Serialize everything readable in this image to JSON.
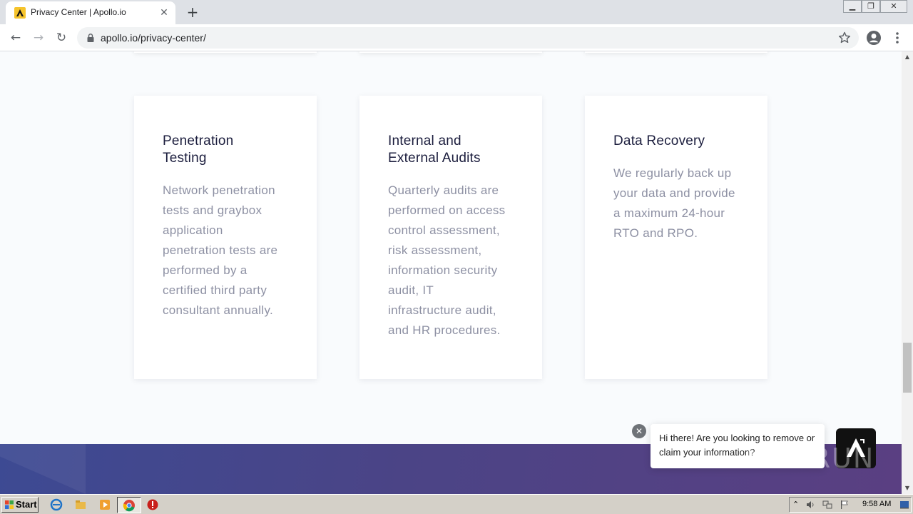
{
  "browser": {
    "tab_title": "Privacy Center | Apollo.io",
    "url": "apollo.io/privacy-center/"
  },
  "cards": [
    {
      "title": "Penetration Testing",
      "text": "Network penetration tests and graybox application penetration tests are performed by a certified third party consultant annually."
    },
    {
      "title": "Internal and External Audits",
      "text": "Quarterly audits are performed on access control assessment, risk assessment, information security audit, IT infrastructure audit, and HR procedures."
    },
    {
      "title": "Data Recovery",
      "text": "We regularly back up your data and provide a maximum 24-hour RTO and RPO."
    }
  ],
  "chat": {
    "message": "Hi there! Are you looking to remove or claim your information?"
  },
  "watermark": {
    "text": "ANY RUN"
  },
  "taskbar": {
    "start_label": "Start",
    "clock": "9:58 AM"
  },
  "colors": {
    "card_title": "#1b1d3d",
    "card_text": "#8d90a3",
    "footer_start": "#3d4a93",
    "footer_end": "#5a3f82",
    "apollo_yellow": "#f6c42c"
  }
}
